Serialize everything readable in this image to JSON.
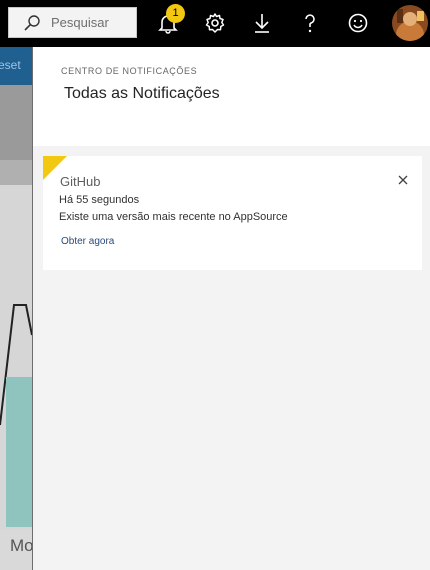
{
  "topbar": {
    "search": {
      "placeholder": "Pesquisar",
      "icon": "search-icon"
    },
    "notification_count": "1",
    "icons": [
      "bell-icon",
      "gear-icon",
      "download-icon",
      "help-icon",
      "smiley-icon"
    ],
    "accent_color": "#f2c811"
  },
  "background_app": {
    "band_text": "eset",
    "bottom_text": "Mo"
  },
  "panel": {
    "label": "CENTRO DE NOTIFICAÇÕES",
    "title": "Todas as Notificações"
  },
  "notification": {
    "source": "GitHub",
    "time": "Há 55 segundos",
    "message": "Existe uma versão mais recente no AppSource",
    "action": "Obter agora",
    "flag_color": "#f2c811"
  }
}
